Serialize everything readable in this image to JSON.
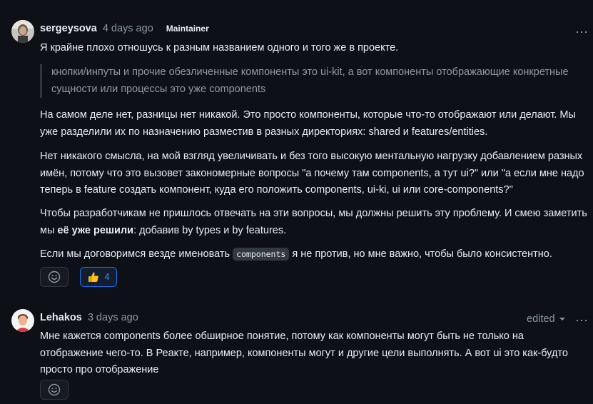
{
  "comments": [
    {
      "author": "sergeysova",
      "time": "4 days ago",
      "role_badge": "Maintainer",
      "paragraph1": "Я крайне плохо отношусь к разным названием одного и того же в проекте.",
      "quote": "кнопки/инпуты и прочие обезличенные компоненты это ui-kit, а вот компоненты отображающие конкретные сущности или процессы это уже components",
      "paragraph2": "На самом деле нет, разницы нет никакой. Это просто компоненты, которые что-то отображают или делают. Мы уже разделили их по назначению разместив в разных директориях: shared и features/entities.",
      "paragraph3": "Нет никакого смысла, на мой взгляд увеличивать и без того высокую ментальную нагрузку добавлением разных имён, потому что это вызовет закономерные вопросы \"а почему там components, а тут ui?\" или \"а если мне надо теперь в feature создать компонент, куда его положить components, ui-ki, ui или core-components?\"",
      "paragraph4_start": "Чтобы разработчикам не пришлось отвечать на эти вопросы, мы должны решить эту проблему. И смею заметить мы ",
      "paragraph4_bold": "её уже решили",
      "paragraph4_end": ": добавив by types и by features.",
      "paragraph5_start": "Если мы договоримся везде именовать ",
      "paragraph5_code": "components",
      "paragraph5_end": " я не против, но мне важно, чтобы было консистентно.",
      "reactions": [
        {
          "icon": "thumbs-up-icon",
          "count": "4"
        }
      ]
    },
    {
      "author": "Lehakos",
      "time": "3 days ago",
      "edited_label": "edited",
      "paragraph1": "Мне кажется components более обширное понятие, потому как компоненты могут быть не только на отображение чего-то. В Реакте, например, компоненты могут и другие цели выполнять. А вот ui это как-будто просто про отображение"
    }
  ],
  "menu_icon": "⋯",
  "colors": {
    "background": "#0d1117",
    "text": "#e6edf3",
    "muted": "#8d96a0",
    "border": "#30363d",
    "accent": "#4493f8"
  }
}
